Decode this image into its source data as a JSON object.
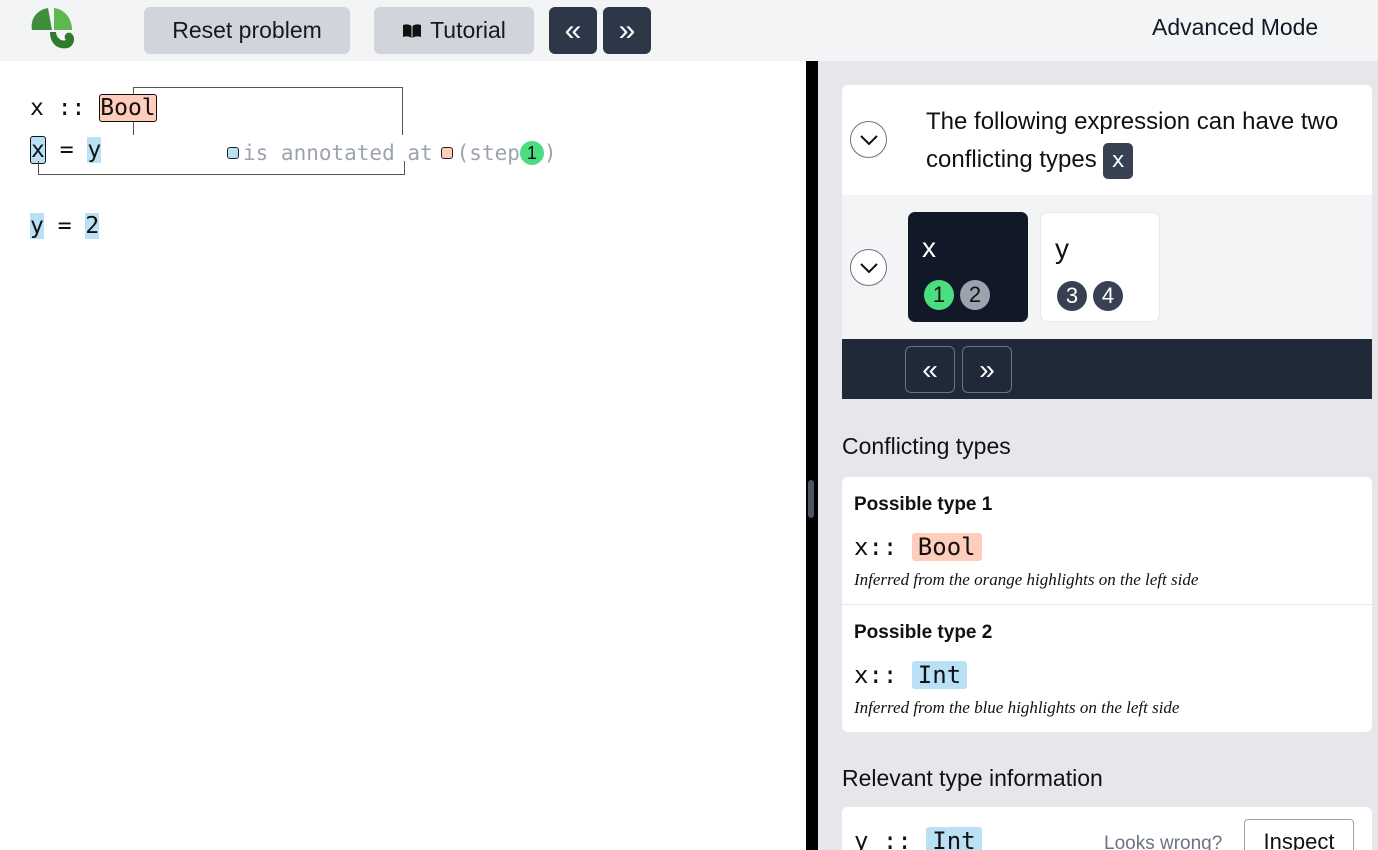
{
  "header": {
    "reset_label": "Reset problem",
    "tutorial_label": "Tutorial",
    "prev_icon": "«",
    "next_icon": "»",
    "mode_label": "Advanced Mode"
  },
  "editor": {
    "line1": {
      "var": "x",
      "op": " :: ",
      "type": "Bool"
    },
    "line2": {
      "lhs": "x",
      "eq": " = ",
      "rhs": "y"
    },
    "ghost": {
      "text": "is annotated at",
      "step_open": "(step",
      "step_num": "1",
      "step_close": ")"
    },
    "line3": {
      "lhs": "y",
      "eq": " = ",
      "rhs": "2"
    }
  },
  "panel": {
    "message": "The following expression can have two conflicting types",
    "message_chip": "x",
    "options": [
      {
        "name": "x",
        "steps": [
          "1",
          "2"
        ],
        "selected": true
      },
      {
        "name": "y",
        "steps": [
          "3",
          "4"
        ],
        "selected": false
      }
    ],
    "nav_prev": "«",
    "nav_next": "»",
    "conflicting_title": "Conflicting types",
    "types": [
      {
        "title": "Possible type 1",
        "var": "x:: ",
        "type": "Bool",
        "note": "Inferred from the orange highlights on the left side"
      },
      {
        "title": "Possible type 2",
        "var": "x:: ",
        "type": "Int",
        "note": "Inferred from the blue highlights on the left side"
      }
    ],
    "relevant_title": "Relevant type information",
    "relevant": {
      "var": "y :: ",
      "type": "Int",
      "looks_wrong": "Looks wrong?",
      "inspect_label": "Inspect"
    }
  },
  "colors": {
    "blue_highlight": "#bae0f5",
    "orange_highlight": "#fecdbc",
    "green_step": "#4ade80",
    "dark": "#1f2937"
  }
}
